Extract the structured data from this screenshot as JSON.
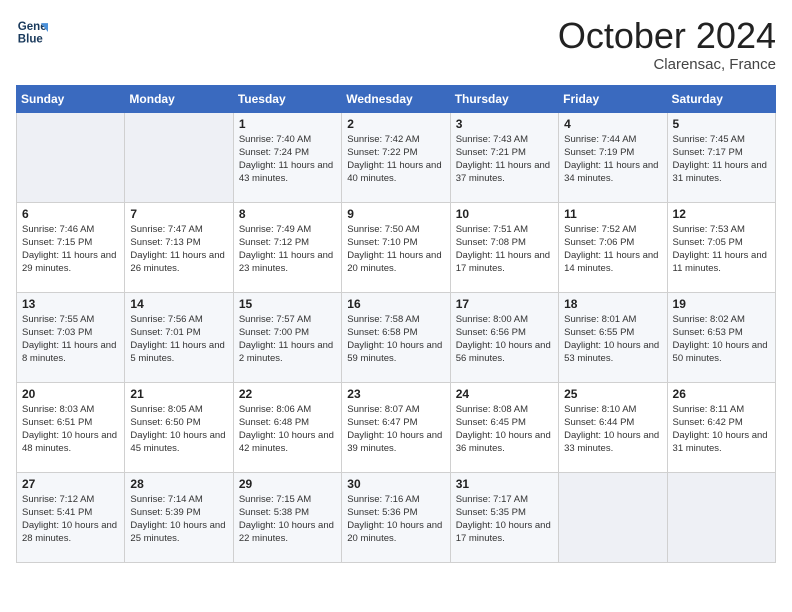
{
  "logo": {
    "line1": "General",
    "line2": "Blue"
  },
  "title": "October 2024",
  "location": "Clarensac, France",
  "days_header": [
    "Sunday",
    "Monday",
    "Tuesday",
    "Wednesday",
    "Thursday",
    "Friday",
    "Saturday"
  ],
  "weeks": [
    [
      {
        "day": "",
        "sunrise": "",
        "sunset": "",
        "daylight": ""
      },
      {
        "day": "",
        "sunrise": "",
        "sunset": "",
        "daylight": ""
      },
      {
        "day": "1",
        "sunrise": "Sunrise: 7:40 AM",
        "sunset": "Sunset: 7:24 PM",
        "daylight": "Daylight: 11 hours and 43 minutes."
      },
      {
        "day": "2",
        "sunrise": "Sunrise: 7:42 AM",
        "sunset": "Sunset: 7:22 PM",
        "daylight": "Daylight: 11 hours and 40 minutes."
      },
      {
        "day": "3",
        "sunrise": "Sunrise: 7:43 AM",
        "sunset": "Sunset: 7:21 PM",
        "daylight": "Daylight: 11 hours and 37 minutes."
      },
      {
        "day": "4",
        "sunrise": "Sunrise: 7:44 AM",
        "sunset": "Sunset: 7:19 PM",
        "daylight": "Daylight: 11 hours and 34 minutes."
      },
      {
        "day": "5",
        "sunrise": "Sunrise: 7:45 AM",
        "sunset": "Sunset: 7:17 PM",
        "daylight": "Daylight: 11 hours and 31 minutes."
      }
    ],
    [
      {
        "day": "6",
        "sunrise": "Sunrise: 7:46 AM",
        "sunset": "Sunset: 7:15 PM",
        "daylight": "Daylight: 11 hours and 29 minutes."
      },
      {
        "day": "7",
        "sunrise": "Sunrise: 7:47 AM",
        "sunset": "Sunset: 7:13 PM",
        "daylight": "Daylight: 11 hours and 26 minutes."
      },
      {
        "day": "8",
        "sunrise": "Sunrise: 7:49 AM",
        "sunset": "Sunset: 7:12 PM",
        "daylight": "Daylight: 11 hours and 23 minutes."
      },
      {
        "day": "9",
        "sunrise": "Sunrise: 7:50 AM",
        "sunset": "Sunset: 7:10 PM",
        "daylight": "Daylight: 11 hours and 20 minutes."
      },
      {
        "day": "10",
        "sunrise": "Sunrise: 7:51 AM",
        "sunset": "Sunset: 7:08 PM",
        "daylight": "Daylight: 11 hours and 17 minutes."
      },
      {
        "day": "11",
        "sunrise": "Sunrise: 7:52 AM",
        "sunset": "Sunset: 7:06 PM",
        "daylight": "Daylight: 11 hours and 14 minutes."
      },
      {
        "day": "12",
        "sunrise": "Sunrise: 7:53 AM",
        "sunset": "Sunset: 7:05 PM",
        "daylight": "Daylight: 11 hours and 11 minutes."
      }
    ],
    [
      {
        "day": "13",
        "sunrise": "Sunrise: 7:55 AM",
        "sunset": "Sunset: 7:03 PM",
        "daylight": "Daylight: 11 hours and 8 minutes."
      },
      {
        "day": "14",
        "sunrise": "Sunrise: 7:56 AM",
        "sunset": "Sunset: 7:01 PM",
        "daylight": "Daylight: 11 hours and 5 minutes."
      },
      {
        "day": "15",
        "sunrise": "Sunrise: 7:57 AM",
        "sunset": "Sunset: 7:00 PM",
        "daylight": "Daylight: 11 hours and 2 minutes."
      },
      {
        "day": "16",
        "sunrise": "Sunrise: 7:58 AM",
        "sunset": "Sunset: 6:58 PM",
        "daylight": "Daylight: 10 hours and 59 minutes."
      },
      {
        "day": "17",
        "sunrise": "Sunrise: 8:00 AM",
        "sunset": "Sunset: 6:56 PM",
        "daylight": "Daylight: 10 hours and 56 minutes."
      },
      {
        "day": "18",
        "sunrise": "Sunrise: 8:01 AM",
        "sunset": "Sunset: 6:55 PM",
        "daylight": "Daylight: 10 hours and 53 minutes."
      },
      {
        "day": "19",
        "sunrise": "Sunrise: 8:02 AM",
        "sunset": "Sunset: 6:53 PM",
        "daylight": "Daylight: 10 hours and 50 minutes."
      }
    ],
    [
      {
        "day": "20",
        "sunrise": "Sunrise: 8:03 AM",
        "sunset": "Sunset: 6:51 PM",
        "daylight": "Daylight: 10 hours and 48 minutes."
      },
      {
        "day": "21",
        "sunrise": "Sunrise: 8:05 AM",
        "sunset": "Sunset: 6:50 PM",
        "daylight": "Daylight: 10 hours and 45 minutes."
      },
      {
        "day": "22",
        "sunrise": "Sunrise: 8:06 AM",
        "sunset": "Sunset: 6:48 PM",
        "daylight": "Daylight: 10 hours and 42 minutes."
      },
      {
        "day": "23",
        "sunrise": "Sunrise: 8:07 AM",
        "sunset": "Sunset: 6:47 PM",
        "daylight": "Daylight: 10 hours and 39 minutes."
      },
      {
        "day": "24",
        "sunrise": "Sunrise: 8:08 AM",
        "sunset": "Sunset: 6:45 PM",
        "daylight": "Daylight: 10 hours and 36 minutes."
      },
      {
        "day": "25",
        "sunrise": "Sunrise: 8:10 AM",
        "sunset": "Sunset: 6:44 PM",
        "daylight": "Daylight: 10 hours and 33 minutes."
      },
      {
        "day": "26",
        "sunrise": "Sunrise: 8:11 AM",
        "sunset": "Sunset: 6:42 PM",
        "daylight": "Daylight: 10 hours and 31 minutes."
      }
    ],
    [
      {
        "day": "27",
        "sunrise": "Sunrise: 7:12 AM",
        "sunset": "Sunset: 5:41 PM",
        "daylight": "Daylight: 10 hours and 28 minutes."
      },
      {
        "day": "28",
        "sunrise": "Sunrise: 7:14 AM",
        "sunset": "Sunset: 5:39 PM",
        "daylight": "Daylight: 10 hours and 25 minutes."
      },
      {
        "day": "29",
        "sunrise": "Sunrise: 7:15 AM",
        "sunset": "Sunset: 5:38 PM",
        "daylight": "Daylight: 10 hours and 22 minutes."
      },
      {
        "day": "30",
        "sunrise": "Sunrise: 7:16 AM",
        "sunset": "Sunset: 5:36 PM",
        "daylight": "Daylight: 10 hours and 20 minutes."
      },
      {
        "day": "31",
        "sunrise": "Sunrise: 7:17 AM",
        "sunset": "Sunset: 5:35 PM",
        "daylight": "Daylight: 10 hours and 17 minutes."
      },
      {
        "day": "",
        "sunrise": "",
        "sunset": "",
        "daylight": ""
      },
      {
        "day": "",
        "sunrise": "",
        "sunset": "",
        "daylight": ""
      }
    ]
  ]
}
